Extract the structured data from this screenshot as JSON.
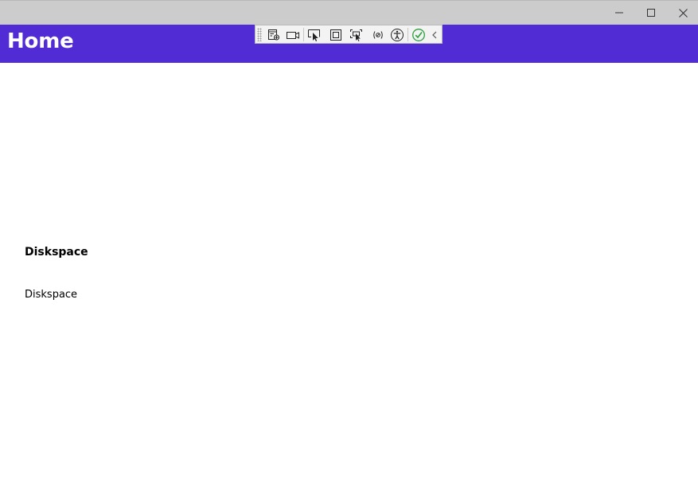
{
  "window": {
    "controls": {
      "minimize_icon": "minimize-icon",
      "maximize_icon": "maximize-icon",
      "close_icon": "close-icon"
    }
  },
  "header": {
    "title": "Home",
    "background": "#512bd4",
    "text_color": "#ffffff"
  },
  "debug_toolbar": {
    "buttons": [
      "live-visual-tree-icon",
      "video-camera-icon",
      "select-element-icon",
      "display-layout-adorners-icon",
      "track-focused-element-icon",
      "binding-failures-icon",
      "accessibility-icon",
      "hot-reload-check-icon",
      "collapse-chevron-icon"
    ],
    "hot_reload_color": "#2e9e3e"
  },
  "content": {
    "heading": "Diskspace",
    "text": "Diskspace"
  }
}
